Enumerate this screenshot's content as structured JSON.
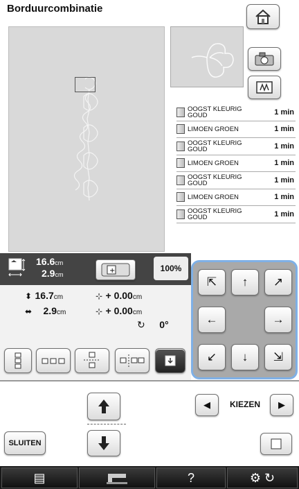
{
  "header": {
    "title": "Borduurcombinatie"
  },
  "threads": [
    {
      "name": "OOGST KLEURIG GOUD",
      "time": "1 min"
    },
    {
      "name": "LIMOEN GROEN",
      "time": "1 min"
    },
    {
      "name": "OOGST KLEURIG GOUD",
      "time": "1 min"
    },
    {
      "name": "LIMOEN GROEN",
      "time": "1 min"
    },
    {
      "name": "OOGST KLEURIG GOUD",
      "time": "1 min"
    },
    {
      "name": "LIMOEN GROEN",
      "time": "1 min"
    },
    {
      "name": "OOGST KLEURIG GOUD",
      "time": "1 min"
    }
  ],
  "size": {
    "width": "16.6",
    "height": "2.9",
    "unit": "cm",
    "zoom": "100%"
  },
  "dimensions": {
    "height": "16.7",
    "width": "2.9",
    "unit": "cm",
    "offset_y": "+ 0.00",
    "offset_x": "+ 0.00",
    "offset_unit": "cm",
    "rotation": "0°"
  },
  "controls": {
    "sluiten": "SLUITEN",
    "kiezen": "KIEZEN"
  },
  "footer": {
    "help": "?"
  }
}
